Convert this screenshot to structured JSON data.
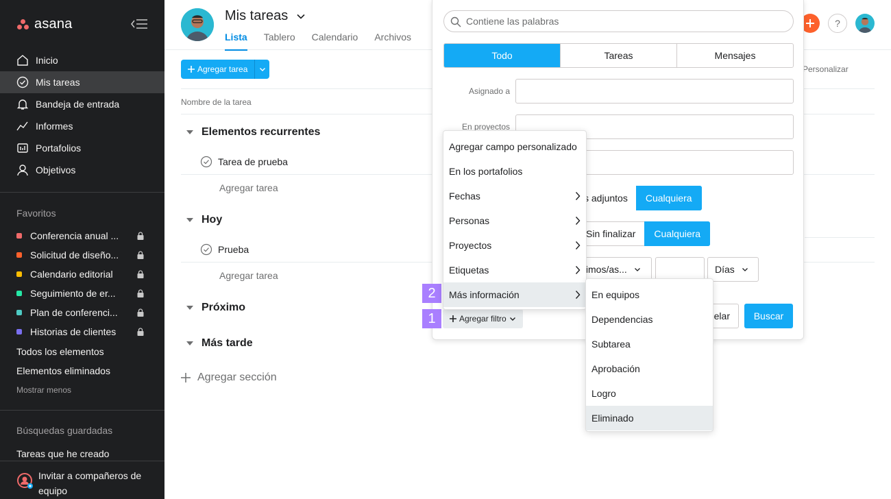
{
  "sidebar": {
    "logo": "asana",
    "nav": [
      {
        "label": "Inicio",
        "icon": "home-icon"
      },
      {
        "label": "Mis tareas",
        "icon": "check-circle-icon"
      },
      {
        "label": "Bandeja de entrada",
        "icon": "bell-icon"
      },
      {
        "label": "Informes",
        "icon": "chart-icon"
      },
      {
        "label": "Portafolios",
        "icon": "portfolio-icon"
      },
      {
        "label": "Objetivos",
        "icon": "person-icon"
      }
    ],
    "favorites_title": "Favoritos",
    "favorites": [
      {
        "label": "Conferencia anual ...",
        "color": "#f06a6a"
      },
      {
        "label": "Solicitud de diseño...",
        "color": "#fd612c"
      },
      {
        "label": "Calendario editorial",
        "color": "#fcbd01"
      },
      {
        "label": "Seguimiento de er...",
        "color": "#25e8a6"
      },
      {
        "label": "Plan de conferenci...",
        "color": "#4ecbc4"
      },
      {
        "label": "Historias de clientes",
        "color": "#7a6ff0"
      }
    ],
    "todos": "Todos los elementos",
    "eliminados": "Elementos eliminados",
    "mostrar_menos": "Mostrar menos",
    "saved_title": "Búsquedas guardadas",
    "saved_item": "Tareas que he creado",
    "invite": "Invitar a compañeros de equipo"
  },
  "header": {
    "title": "Mis tareas",
    "tabs": [
      "Lista",
      "Tablero",
      "Calendario",
      "Archivos"
    ],
    "help": "?"
  },
  "toolbar": {
    "add_task": "Agregar tarea",
    "personalizar": "Personalizar"
  },
  "list": {
    "column_header": "Nombre de la tarea",
    "sections": [
      {
        "title": "Elementos recurrentes",
        "task": "Tarea de prueba",
        "add": "Agregar tarea"
      },
      {
        "title": "Hoy",
        "task": "Prueba",
        "add": "Agregar tarea"
      },
      {
        "title": "Próximo"
      },
      {
        "title": "Más tarde"
      }
    ],
    "add_section": "Agregar sección"
  },
  "search": {
    "placeholder": "Contiene las palabras",
    "segments": [
      "Todo",
      "Tareas",
      "Mensajes"
    ],
    "asignado": "Asignado a",
    "proyectos": "En proyectos",
    "adjuntos": "s adjuntos",
    "cualquiera1": "Cualquiera",
    "sin_finalizar": "Sin finalizar",
    "cualquiera2": "Cualquiera",
    "fecha_sel": "timos/as...",
    "dias": "Días",
    "cancel": "elar",
    "buscar": "Buscar",
    "add_filter": "Agregar filtro"
  },
  "steps": [
    "1",
    "2"
  ],
  "filter_menu": [
    {
      "label": "Agregar campo personalizado",
      "sub": false
    },
    {
      "label": "En los portafolios",
      "sub": false
    },
    {
      "label": "Fechas",
      "sub": true
    },
    {
      "label": "Personas",
      "sub": true
    },
    {
      "label": "Proyectos",
      "sub": true
    },
    {
      "label": "Etiquetas",
      "sub": true
    },
    {
      "label": "Más información",
      "sub": true
    }
  ],
  "submenu": [
    "En equipos",
    "Dependencias",
    "Subtarea",
    "Aprobación",
    "Logro",
    "Eliminado"
  ],
  "colors": {
    "accent": "#14aaf5",
    "sidebar": "#1e1f21",
    "step": "#a97fff"
  }
}
